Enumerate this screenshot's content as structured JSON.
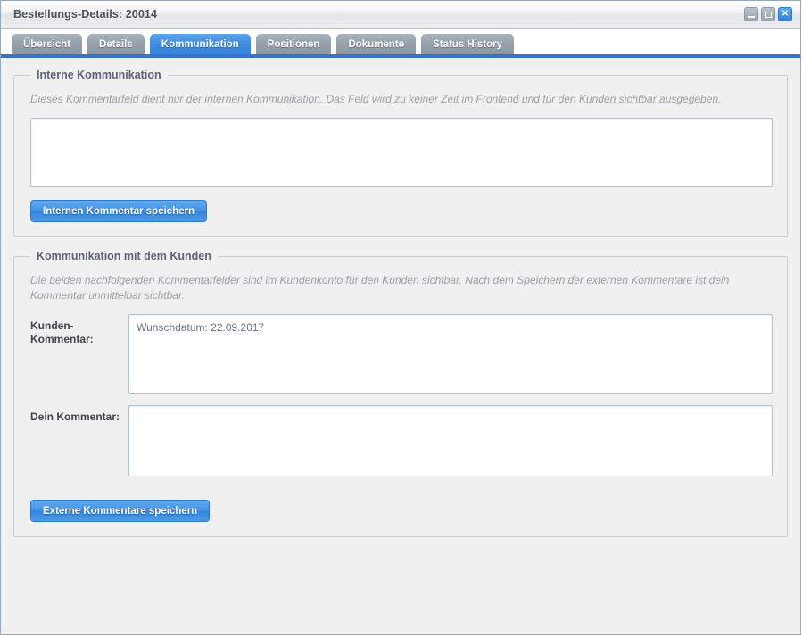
{
  "window": {
    "title": "Bestellungs-Details: 20014",
    "controls": {
      "minimize": "minimize-icon",
      "maximize": "maximize-icon",
      "close": "✕"
    }
  },
  "tabs": [
    {
      "label": "Übersicht",
      "active": false
    },
    {
      "label": "Details",
      "active": false
    },
    {
      "label": "Kommunikation",
      "active": true
    },
    {
      "label": "Positionen",
      "active": false
    },
    {
      "label": "Dokumente",
      "active": false
    },
    {
      "label": "Status History",
      "active": false
    }
  ],
  "internal_section": {
    "legend": "Interne Kommunikation",
    "hint": "Dieses Kommentarfeld dient nur der internen Kommunikation. Das Feld wird zu keiner Zeit im Frontend und für den Kunden sichtbar ausgegeben.",
    "textarea_value": "",
    "textarea_placeholder": "",
    "save_button": "Internen Kommentar speichern"
  },
  "customer_section": {
    "legend": "Kommunikation mit dem Kunden",
    "hint": "Die beiden nachfolgenden Kommentarfelder sind im Kundenkonto für den Kunden sichtbar. Nach dem Speichern der externen Kommentare ist dein Kommentar unmittelbar sichtbar.",
    "customer_comment_label": "Kunden-Kommentar:",
    "customer_comment_value": "Wunschdatum: 22.09.2017",
    "own_comment_label": "Dein Kommentar:",
    "own_comment_value": "",
    "save_button": "Externe Kommentare speichern"
  },
  "colors": {
    "accent_blue": "#3a8fe0",
    "tab_underline": "#3a72c8",
    "inactive_tab": "#95a0ab",
    "panel_bg": "#f0f0f0",
    "legend_text": "#5b6376",
    "hint_text": "#9aa0a8"
  }
}
